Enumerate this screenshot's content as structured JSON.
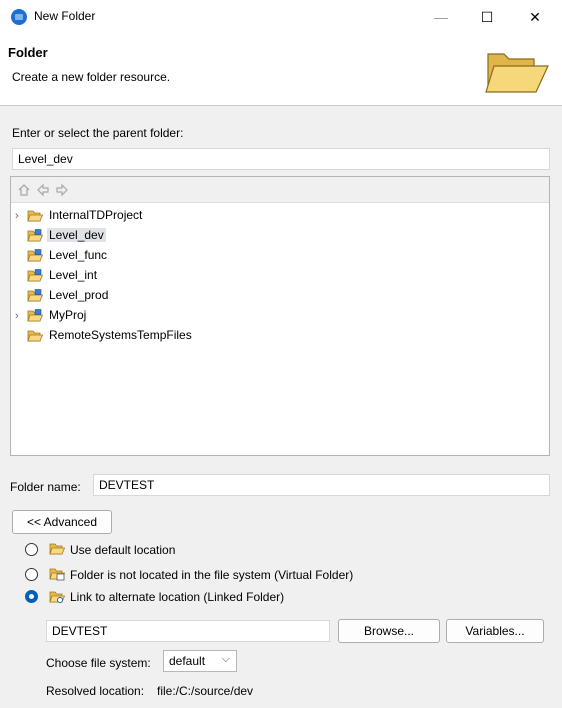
{
  "window": {
    "title": "New Folder",
    "minimize": "—",
    "maximize": "☐",
    "close": "✕"
  },
  "banner": {
    "title": "Folder",
    "description": "Create a new folder resource."
  },
  "parent": {
    "label": "Enter or select the parent folder:",
    "value": "Level_dev"
  },
  "tree": {
    "items": [
      {
        "label": "InternalTDProject",
        "expandable": true,
        "selected": false,
        "icon": "open-folder-icon"
      },
      {
        "label": "Level_dev",
        "expandable": false,
        "selected": true,
        "icon": "project-folder-icon"
      },
      {
        "label": "Level_func",
        "expandable": false,
        "selected": false,
        "icon": "project-folder-icon"
      },
      {
        "label": "Level_int",
        "expandable": false,
        "selected": false,
        "icon": "project-folder-icon"
      },
      {
        "label": "Level_prod",
        "expandable": false,
        "selected": false,
        "icon": "project-folder-icon"
      },
      {
        "label": "MyProj",
        "expandable": true,
        "selected": false,
        "icon": "project-folder-icon"
      },
      {
        "label": "RemoteSystemsTempFiles",
        "expandable": false,
        "selected": false,
        "icon": "open-folder-icon"
      }
    ]
  },
  "folder_name": {
    "label": "Folder name:",
    "value": "DEVTEST"
  },
  "advanced_button": "<< Advanced",
  "options": {
    "default_location": "Use default location",
    "virtual_folder": "Folder is not located in the file system (Virtual Folder)",
    "linked_folder": "Link to alternate location (Linked Folder)"
  },
  "link": {
    "location_value": "DEVTEST",
    "browse_label": "Browse...",
    "variables_label": "Variables..."
  },
  "file_system": {
    "label": "Choose file system:",
    "selected": "default"
  },
  "resolved": {
    "label": "Resolved location:",
    "value": "file:/C:/source/dev"
  },
  "colors": {
    "accent": "#005fb8",
    "selection": "#dfe3e8",
    "folder": "#f2c94c"
  }
}
